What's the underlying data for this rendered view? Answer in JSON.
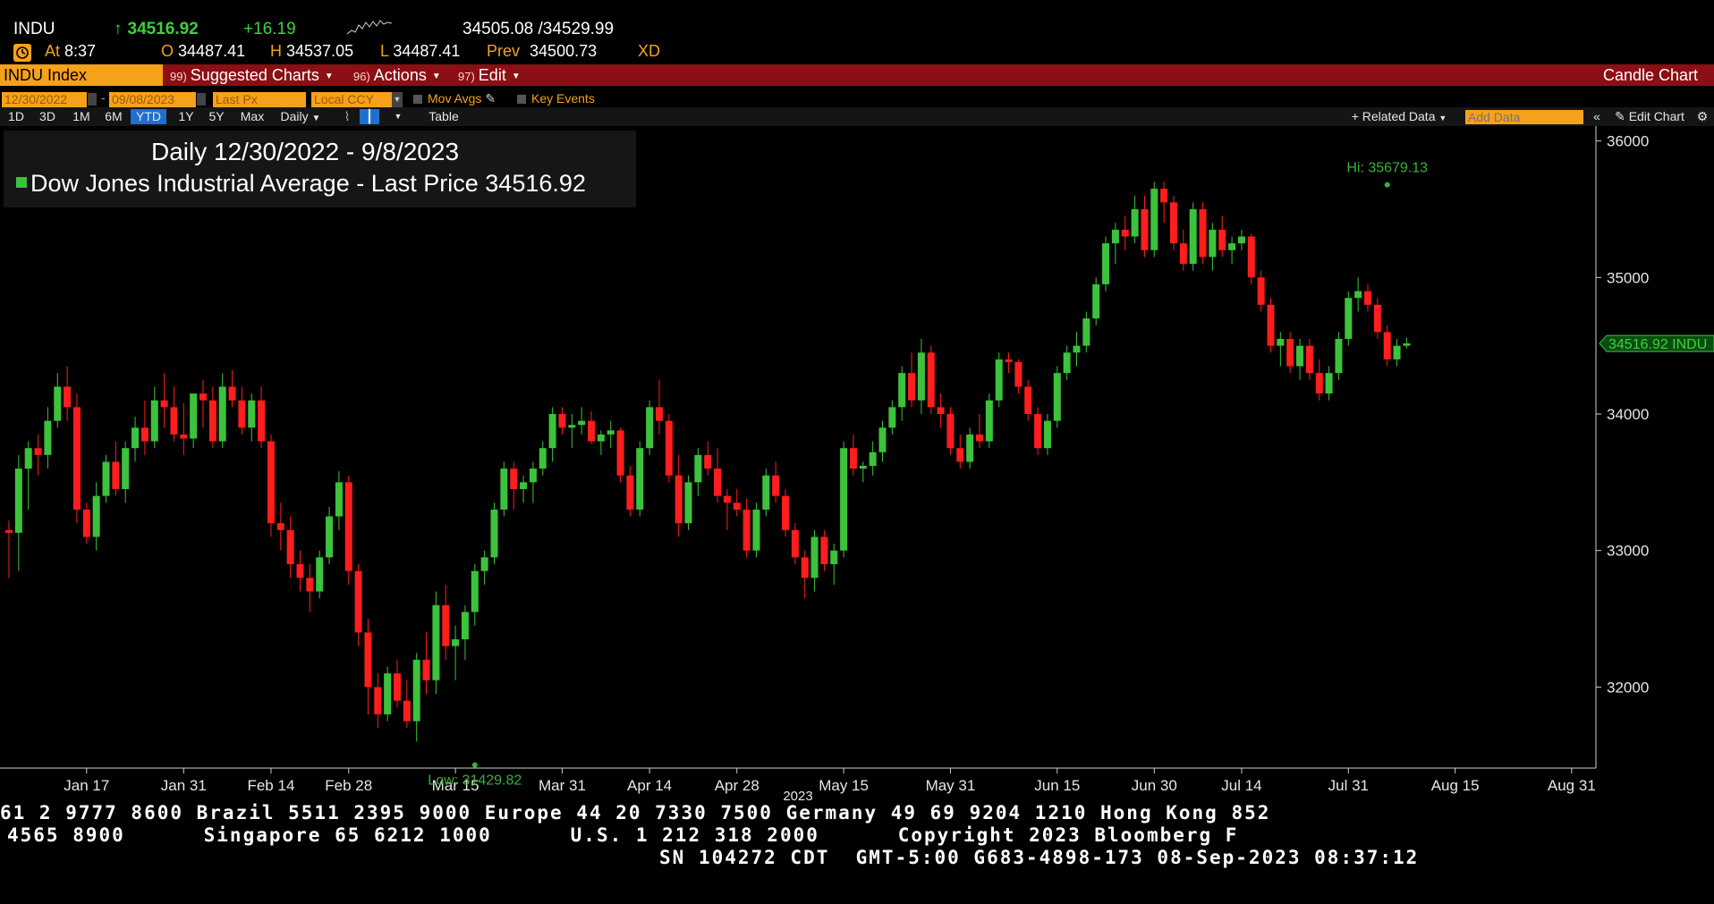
{
  "quote": {
    "ticker": "INDU",
    "arrow": "↑",
    "last": "34516.92",
    "change": "+16.19",
    "bid_ask": "34505.08 /34529.99",
    "time_label": "At",
    "time": "8:37",
    "open_label": "O",
    "open": "34487.41",
    "high_label": "H",
    "high": "34537.05",
    "low_label": "L",
    "low": "34487.41",
    "prev_label": "Prev",
    "prev": "34500.73",
    "flag": "XD"
  },
  "menubar": {
    "ticker_field": "INDU Index",
    "items": [
      {
        "num": "99)",
        "label": "Suggested Charts"
      },
      {
        "num": "96)",
        "label": "Actions"
      },
      {
        "num": "97)",
        "label": "Edit"
      }
    ],
    "right_label": "Candle Chart"
  },
  "controls": {
    "start_date": "12/30/2022",
    "end_date": "09/08/2023",
    "field": "Last Px",
    "currency": "Local CCY",
    "mov_avgs": "Mov Avgs",
    "key_events": "Key Events",
    "related_data": "Related Data",
    "add_data_placeholder": "Add Data",
    "edit_chart": "Edit Chart",
    "periods": [
      "1D",
      "3D",
      "1M",
      "6M",
      "YTD",
      "1Y",
      "5Y",
      "Max"
    ],
    "selected_period": "YTD",
    "frequency": "Daily",
    "table": "Table"
  },
  "legend": {
    "title": "Daily 12/30/2022 - 9/8/2023",
    "series": "Dow Jones Industrial Average - Last Price",
    "value": "34516.92"
  },
  "chart_data": {
    "type": "candlestick",
    "title": "Daily 12/30/2022 - 9/8/2023",
    "ylim": [
      31400,
      36050
    ],
    "y_ticks": [
      32000,
      33000,
      34000,
      35000,
      36000
    ],
    "x_tick_labels": [
      "Jan 17",
      "Jan 31",
      "Feb 14",
      "Feb 28",
      "Mar 15",
      "Mar 31",
      "Apr 14",
      "Apr 28",
      "May 15",
      "May 31",
      "Jun 15",
      "Jun 30",
      "Jul 14",
      "Jul 31",
      "Aug 15",
      "Aug 31"
    ],
    "x_tick_index": [
      8,
      18,
      27,
      35,
      46,
      57,
      66,
      75,
      86,
      97,
      108,
      118,
      127,
      138,
      149,
      161
    ],
    "year_label": "2023",
    "last_price_label": "34516.92 INDU",
    "last_price": 34516.92,
    "hi_label": "Hi: 35679.13",
    "hi_value": 35679.13,
    "hi_index": 142,
    "low_label": "Low: 31429.82",
    "low_value": 31429.82,
    "low_index": 48,
    "colors": {
      "up": "#3cc23c",
      "down": "#ff1d1d",
      "axis": "#cfcfcf",
      "annot": "#3ab03a"
    },
    "candles": [
      [
        33150,
        33220,
        32800,
        33130
      ],
      [
        33130,
        33700,
        32850,
        33600
      ],
      [
        33600,
        33800,
        33300,
        33750
      ],
      [
        33750,
        33850,
        33550,
        33700
      ],
      [
        33700,
        34050,
        33600,
        33950
      ],
      [
        33950,
        34300,
        33900,
        34200
      ],
      [
        34200,
        34350,
        33950,
        34050
      ],
      [
        34050,
        34150,
        33200,
        33300
      ],
      [
        33300,
        33350,
        33050,
        33100
      ],
      [
        33100,
        33500,
        33000,
        33400
      ],
      [
        33400,
        33700,
        33350,
        33650
      ],
      [
        33650,
        33800,
        33400,
        33450
      ],
      [
        33450,
        33800,
        33350,
        33750
      ],
      [
        33750,
        33980,
        33650,
        33900
      ],
      [
        33900,
        34100,
        33700,
        33800
      ],
      [
        33800,
        34200,
        33750,
        34100
      ],
      [
        34100,
        34300,
        33900,
        34050
      ],
      [
        34050,
        34200,
        33800,
        33850
      ],
      [
        33850,
        34080,
        33700,
        33820
      ],
      [
        33820,
        34150,
        33750,
        34150
      ],
      [
        34150,
        34250,
        33900,
        34100
      ],
      [
        34100,
        34200,
        33750,
        33800
      ],
      [
        33800,
        34300,
        33750,
        34200
      ],
      [
        34200,
        34320,
        34050,
        34100
      ],
      [
        34100,
        34200,
        33850,
        33900
      ],
      [
        33900,
        34150,
        33800,
        34100
      ],
      [
        34100,
        34200,
        33750,
        33800
      ],
      [
        33800,
        33850,
        33100,
        33200
      ],
      [
        33200,
        33350,
        33000,
        33150
      ],
      [
        33150,
        33250,
        32800,
        32900
      ],
      [
        32900,
        33000,
        32700,
        32800
      ],
      [
        32800,
        32900,
        32550,
        32700
      ],
      [
        32700,
        33000,
        32650,
        32950
      ],
      [
        32950,
        33320,
        32900,
        33250
      ],
      [
        33250,
        33580,
        33150,
        33500
      ],
      [
        33500,
        33550,
        32750,
        32850
      ],
      [
        32850,
        32900,
        32300,
        32400
      ],
      [
        32400,
        32500,
        31800,
        32000
      ],
      [
        32000,
        32100,
        31700,
        31800
      ],
      [
        31800,
        32150,
        31750,
        32100
      ],
      [
        32100,
        32200,
        31850,
        31900
      ],
      [
        31900,
        32050,
        31700,
        31750
      ],
      [
        31750,
        32250,
        31600,
        32200
      ],
      [
        32200,
        32400,
        31950,
        32050
      ],
      [
        32050,
        32700,
        31950,
        32600
      ],
      [
        32600,
        32750,
        32200,
        32300
      ],
      [
        32300,
        32450,
        32050,
        32350
      ],
      [
        32350,
        32600,
        32200,
        32550
      ],
      [
        32550,
        32900,
        32450,
        32850
      ],
      [
        32850,
        33000,
        32750,
        32950
      ],
      [
        32950,
        33350,
        32900,
        33300
      ],
      [
        33300,
        33650,
        33250,
        33600
      ],
      [
        33600,
        33650,
        33300,
        33450
      ],
      [
        33450,
        33550,
        33350,
        33500
      ],
      [
        33500,
        33650,
        33350,
        33600
      ],
      [
        33600,
        33800,
        33550,
        33750
      ],
      [
        33750,
        34050,
        33650,
        34000
      ],
      [
        34000,
        34050,
        33850,
        33900
      ],
      [
        33900,
        34000,
        33750,
        33920
      ],
      [
        33920,
        34050,
        33850,
        33950
      ],
      [
        33950,
        34020,
        33780,
        33800
      ],
      [
        33800,
        33880,
        33700,
        33850
      ],
      [
        33850,
        33950,
        33750,
        33880
      ],
      [
        33880,
        33900,
        33500,
        33550
      ],
      [
        33550,
        33620,
        33250,
        33300
      ],
      [
        33300,
        33800,
        33250,
        33750
      ],
      [
        33750,
        34100,
        33700,
        34050
      ],
      [
        34050,
        34250,
        33850,
        33950
      ],
      [
        33950,
        34000,
        33500,
        33550
      ],
      [
        33550,
        33700,
        33100,
        33200
      ],
      [
        33200,
        33550,
        33150,
        33500
      ],
      [
        33500,
        33750,
        33400,
        33700
      ],
      [
        33700,
        33800,
        33550,
        33600
      ],
      [
        33600,
        33750,
        33350,
        33400
      ],
      [
        33400,
        33450,
        33150,
        33350
      ],
      [
        33350,
        33450,
        33250,
        33300
      ],
      [
        33300,
        33380,
        32950,
        33000
      ],
      [
        33000,
        33350,
        32950,
        33300
      ],
      [
        33300,
        33600,
        33250,
        33550
      ],
      [
        33550,
        33650,
        33350,
        33400
      ],
      [
        33400,
        33450,
        33100,
        33150
      ],
      [
        33150,
        33200,
        32900,
        32950
      ],
      [
        32950,
        33000,
        32650,
        32800
      ],
      [
        32800,
        33150,
        32700,
        33100
      ],
      [
        33100,
        33150,
        32850,
        32900
      ],
      [
        32900,
        33050,
        32750,
        33000
      ],
      [
        33000,
        33800,
        32950,
        33750
      ],
      [
        33750,
        33850,
        33550,
        33600
      ],
      [
        33600,
        33650,
        33500,
        33620
      ],
      [
        33620,
        33800,
        33550,
        33720
      ],
      [
        33720,
        33950,
        33650,
        33900
      ],
      [
        33900,
        34100,
        33850,
        34050
      ],
      [
        34050,
        34350,
        33950,
        34300
      ],
      [
        34300,
        34450,
        34050,
        34100
      ],
      [
        34100,
        34550,
        34000,
        34450
      ],
      [
        34450,
        34500,
        34000,
        34050
      ],
      [
        34050,
        34150,
        33900,
        34000
      ],
      [
        34000,
        34050,
        33700,
        33750
      ],
      [
        33750,
        33850,
        33600,
        33650
      ],
      [
        33650,
        33900,
        33600,
        33850
      ],
      [
        33850,
        34000,
        33750,
        33800
      ],
      [
        33800,
        34150,
        33750,
        34100
      ],
      [
        34100,
        34450,
        34050,
        34400
      ],
      [
        34400,
        34450,
        34300,
        34380
      ],
      [
        34380,
        34400,
        34150,
        34200
      ],
      [
        34200,
        34250,
        33950,
        34000
      ],
      [
        34000,
        34050,
        33700,
        33750
      ],
      [
        33750,
        34000,
        33700,
        33950
      ],
      [
        33950,
        34350,
        33900,
        34300
      ],
      [
        34300,
        34500,
        34250,
        34450
      ],
      [
        34450,
        34600,
        34350,
        34500
      ],
      [
        34500,
        34750,
        34450,
        34700
      ],
      [
        34700,
        35000,
        34650,
        34950
      ],
      [
        34950,
        35300,
        34900,
        35250
      ],
      [
        35250,
        35400,
        35100,
        35350
      ],
      [
        35350,
        35450,
        35200,
        35300
      ],
      [
        35300,
        35600,
        35250,
        35500
      ],
      [
        35500,
        35600,
        35150,
        35200
      ],
      [
        35200,
        35700,
        35150,
        35650
      ],
      [
        35650,
        35700,
        35400,
        35550
      ],
      [
        35550,
        35600,
        35200,
        35250
      ],
      [
        35250,
        35350,
        35050,
        35100
      ],
      [
        35100,
        35550,
        35050,
        35500
      ],
      [
        35500,
        35550,
        35100,
        35150
      ],
      [
        35150,
        35400,
        35050,
        35350
      ],
      [
        35350,
        35450,
        35150,
        35200
      ],
      [
        35200,
        35300,
        35100,
        35250
      ],
      [
        35250,
        35350,
        35200,
        35300
      ],
      [
        35300,
        35320,
        34950,
        35000
      ],
      [
        35000,
        35050,
        34750,
        34800
      ],
      [
        34800,
        34850,
        34450,
        34500
      ],
      [
        34500,
        34600,
        34350,
        34550
      ],
      [
        34550,
        34600,
        34300,
        34350
      ],
      [
        34350,
        34550,
        34250,
        34500
      ],
      [
        34500,
        34550,
        34250,
        34300
      ],
      [
        34300,
        34400,
        34100,
        34150
      ],
      [
        34150,
        34350,
        34100,
        34300
      ],
      [
        34300,
        34600,
        34250,
        34550
      ],
      [
        34550,
        34900,
        34500,
        34850
      ],
      [
        34850,
        35000,
        34750,
        34900
      ],
      [
        34900,
        34950,
        34750,
        34800
      ],
      [
        34800,
        34850,
        34550,
        34600
      ],
      [
        34600,
        34650,
        34350,
        34400
      ],
      [
        34400,
        34550,
        34350,
        34500
      ],
      [
        34500,
        34560,
        34480,
        34517
      ]
    ]
  },
  "footer": {
    "line1": "61 2 9777 8600 Brazil 5511 2395 9000 Europe 44 20 7330 7500 Germany 49 69 9204 1210 Hong Kong 852",
    "line2": "4565 8900      Singapore 65 6212 1000      U.S. 1 212 318 2000      Copyright 2023 Bloomberg F",
    "line3": "SN 104272 CDT  GMT-5:00 G683-4898-173 08-Sep-2023 08:37:12"
  }
}
